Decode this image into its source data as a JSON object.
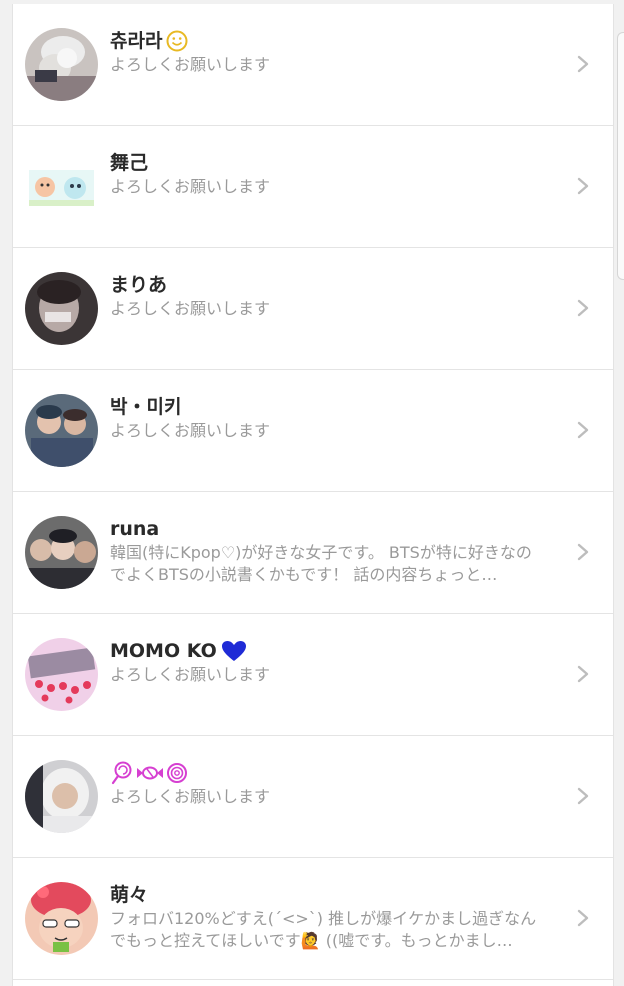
{
  "users": [
    {
      "name": "츄라라",
      "name_emoji": "smiley-icon",
      "bio": "よろしくお願いします"
    },
    {
      "name": "舞己",
      "bio": "よろしくお願いします"
    },
    {
      "name": "まりあ",
      "bio": "よろしくお願いします"
    },
    {
      "name": "박・미키",
      "bio": "よろしくお願いします"
    },
    {
      "name": "runa",
      "bio": "韓国(特にKpop♡)が好きな女子です。 BTSが特に好きなのでよくBTSの小説書くかもです！ 話の内容ちょっと…"
    },
    {
      "name": "MOMO KO",
      "name_emoji": "blue-heart-icon",
      "bio": "よろしくお願いします"
    },
    {
      "name": "",
      "name_emoji": "lollipop-candy-icons",
      "bio": "よろしくお願いします"
    },
    {
      "name": "萌々",
      "bio": "フォロバ120%どすえ(´<>`) 推しが爆イケかまし過ぎなんでもっと控えてほしいです🙋 ((嘘です。もっとかまし…"
    }
  ],
  "colors": {
    "background": "#f1f1f1",
    "card": "#ffffff",
    "name_text": "#2a2a2a",
    "bio_text": "#9a9a9a",
    "chevron": "#bdbdbd",
    "heart": "#1f2bd6",
    "candy": "#d63fd1"
  }
}
